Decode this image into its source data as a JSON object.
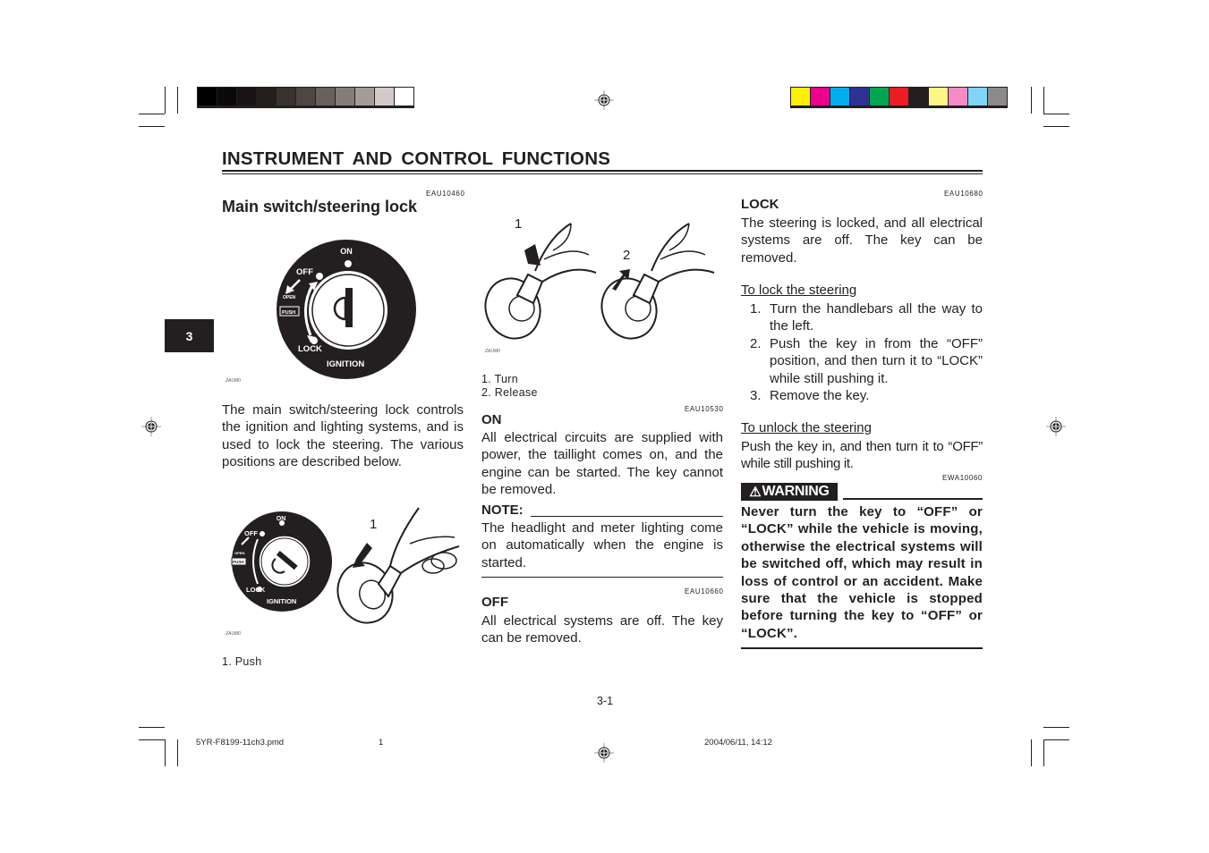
{
  "print_marks": {
    "grayscale_swatches": [
      "#000000",
      "#0c0a09",
      "#181413",
      "#231f1d",
      "#3a3230",
      "#4e4644",
      "#6a605d",
      "#857b79",
      "#a59c9a",
      "#d3cac9",
      "#ffffff"
    ],
    "color_swatches": [
      "#fff200",
      "#ec008c",
      "#00aeef",
      "#2e3192",
      "#00a651",
      "#ed1c24",
      "#231f20",
      "#fff685",
      "#f68bc6",
      "#7fd5f7",
      "#8c8a8a"
    ]
  },
  "header": {
    "title": "INSTRUMENT AND CONTROL FUNCTIONS",
    "chapter_tab": "3"
  },
  "left_column": {
    "code": "EAU10460",
    "heading": "Main switch/steering lock",
    "figure1": {
      "labels": {
        "on": "ON",
        "off": "OFF",
        "open": "OPEN",
        "push": "PUSH",
        "lock": "LOCK",
        "ignition": "IGNITION"
      },
      "fig_id": "ZAUM0"
    },
    "intro": "The main switch/steering lock controls the ignition and lighting systems, and is used to lock the steering. The various positions are described below.",
    "figure2": {
      "labels": {
        "on": "ON",
        "off": "OFF",
        "open": "OPEN",
        "push": "PUSH",
        "lock": "LOCK",
        "ignition": "IGNITION"
      },
      "callout": "1",
      "fig_id": "ZAUM0"
    },
    "caption": "1.  Push"
  },
  "middle_column": {
    "figure": {
      "callout1": "1",
      "callout2": "2",
      "fig_id": "ZAUM0"
    },
    "captions": [
      "1.  Turn",
      "2.  Release"
    ],
    "on": {
      "code": "EAU10530",
      "heading": "ON",
      "text": "All electrical circuits are supplied with power, the taillight comes on, and the engine can be started. The key cannot be removed."
    },
    "note": {
      "label": "NOTE:",
      "text": "The headlight and meter lighting come on automatically when the engine is started."
    },
    "off": {
      "code": "EAU10660",
      "heading": "OFF",
      "text": "All electrical systems are off. The key can be removed."
    }
  },
  "right_column": {
    "lock": {
      "code": "EAU10680",
      "heading": "LOCK",
      "text": "The steering is locked, and all electrical systems are off. The key can be removed."
    },
    "to_lock": {
      "title": "To lock the steering",
      "steps": [
        {
          "n": "1.",
          "text": "Turn the handlebars all the way to the left."
        },
        {
          "n": "2.",
          "text": "Push the key in from the “OFF” position, and then turn it to “LOCK” while still pushing it."
        },
        {
          "n": "3.",
          "text": "Remove the key."
        }
      ]
    },
    "to_unlock": {
      "title": "To unlock the steering",
      "text": "Push the key in, and then turn it to “OFF” while still pushing it."
    },
    "warning": {
      "code": "EWA10060",
      "label": "WARNING",
      "text": "Never turn the key to “OFF” or “LOCK” while the vehicle is moving, otherwise the electrical systems will be switched off, which may result in loss of control or an accident. Make sure that the vehicle is stopped before turning the key to “OFF” or “LOCK”."
    }
  },
  "footer": {
    "page_number": "3-1",
    "file_name": "5YR-F8199-11ch3.pmd",
    "sheet": "1",
    "timestamp": "2004/06/11, 14:12"
  }
}
